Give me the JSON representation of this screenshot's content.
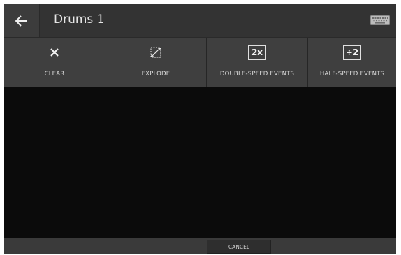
{
  "header": {
    "title": "Drums 1",
    "back_icon": "arrow-left-icon",
    "keyboard_icon": "keyboard-icon"
  },
  "tools": [
    {
      "label": "CLEAR",
      "icon": "close-icon"
    },
    {
      "label": "EXPLODE",
      "icon": "explode-icon"
    },
    {
      "label": "DOUBLE-SPEED EVENTS",
      "icon": "double-speed-icon",
      "icon_text": "2x"
    },
    {
      "label": "HALF-SPEED EVENTS",
      "icon": "half-speed-icon",
      "icon_text": "÷2"
    }
  ],
  "footer": {
    "cancel_label": "CANCEL"
  },
  "colors": {
    "background": "#0b0b0b",
    "bar": "#3f3f3f",
    "text": "#dcdcdc"
  }
}
